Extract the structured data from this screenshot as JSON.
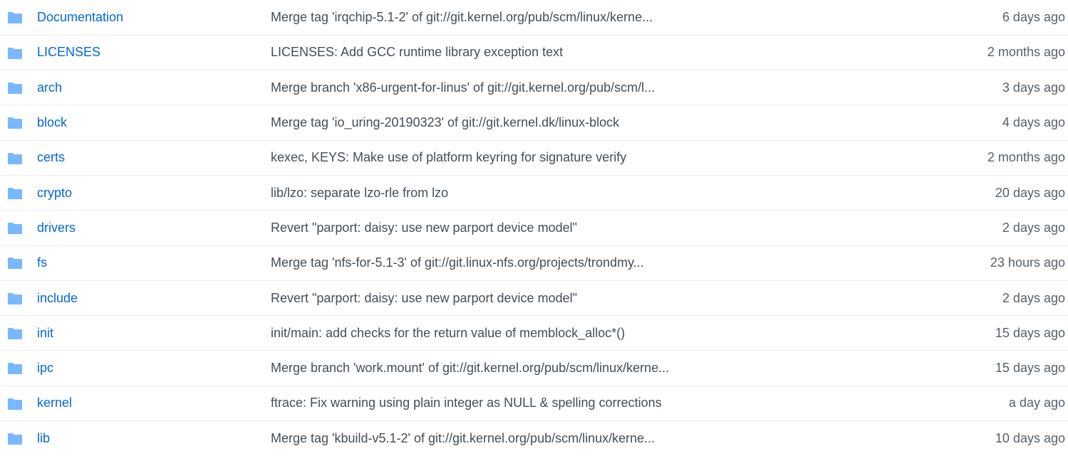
{
  "accent": "#0366d6",
  "icon_color": "#79b8ff",
  "rows": [
    {
      "icon": "folder-icon",
      "name": "Documentation",
      "message": "Merge tag 'irqchip-5.1-2' of git://git.kernel.org/pub/scm/linux/kerne...",
      "age": "6 days ago"
    },
    {
      "icon": "folder-icon",
      "name": "LICENSES",
      "message": "LICENSES: Add GCC runtime library exception text",
      "age": "2 months ago"
    },
    {
      "icon": "folder-icon",
      "name": "arch",
      "message": "Merge branch 'x86-urgent-for-linus' of git://git.kernel.org/pub/scm/l...",
      "age": "3 days ago"
    },
    {
      "icon": "folder-icon",
      "name": "block",
      "message": "Merge tag 'io_uring-20190323' of git://git.kernel.dk/linux-block",
      "age": "4 days ago"
    },
    {
      "icon": "folder-icon",
      "name": "certs",
      "message": "kexec, KEYS: Make use of platform keyring for signature verify",
      "age": "2 months ago"
    },
    {
      "icon": "folder-icon",
      "name": "crypto",
      "message": "lib/lzo: separate lzo-rle from lzo",
      "age": "20 days ago"
    },
    {
      "icon": "folder-icon",
      "name": "drivers",
      "message": "Revert \"parport: daisy: use new parport device model\"",
      "age": "2 days ago"
    },
    {
      "icon": "folder-icon",
      "name": "fs",
      "message": "Merge tag 'nfs-for-5.1-3' of git://git.linux-nfs.org/projects/trondmy...",
      "age": "23 hours ago"
    },
    {
      "icon": "folder-icon",
      "name": "include",
      "message": "Revert \"parport: daisy: use new parport device model\"",
      "age": "2 days ago"
    },
    {
      "icon": "folder-icon",
      "name": "init",
      "message": "init/main: add checks for the return value of memblock_alloc*()",
      "age": "15 days ago"
    },
    {
      "icon": "folder-icon",
      "name": "ipc",
      "message": "Merge branch 'work.mount' of git://git.kernel.org/pub/scm/linux/kerne...",
      "age": "15 days ago"
    },
    {
      "icon": "folder-icon",
      "name": "kernel",
      "message": "ftrace: Fix warning using plain integer as NULL & spelling corrections",
      "age": "a day ago"
    },
    {
      "icon": "folder-icon",
      "name": "lib",
      "message": "Merge tag 'kbuild-v5.1-2' of git://git.kernel.org/pub/scm/linux/kerne...",
      "age": "10 days ago"
    }
  ]
}
